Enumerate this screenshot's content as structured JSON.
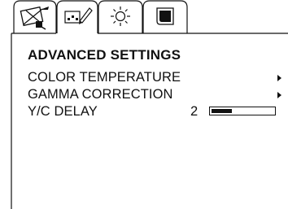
{
  "menu": {
    "title": "ADVANCED SETTINGS",
    "items": [
      {
        "label": "COLOR TEMPERATURE",
        "has_submenu": true
      },
      {
        "label": "GAMMA CORRECTION",
        "has_submenu": true
      },
      {
        "label": "Y/C DELAY",
        "value": "2",
        "level_fraction": 0.33
      }
    ]
  },
  "tabs": [
    {
      "icon": "picture-setting-icon",
      "selected": false
    },
    {
      "icon": "advanced-settings-icon",
      "selected": true
    },
    {
      "icon": "brightness-icon",
      "selected": false
    },
    {
      "icon": "screen-icon",
      "selected": false
    }
  ],
  "colors": {
    "line": "#111111",
    "background": "#ffffff"
  }
}
